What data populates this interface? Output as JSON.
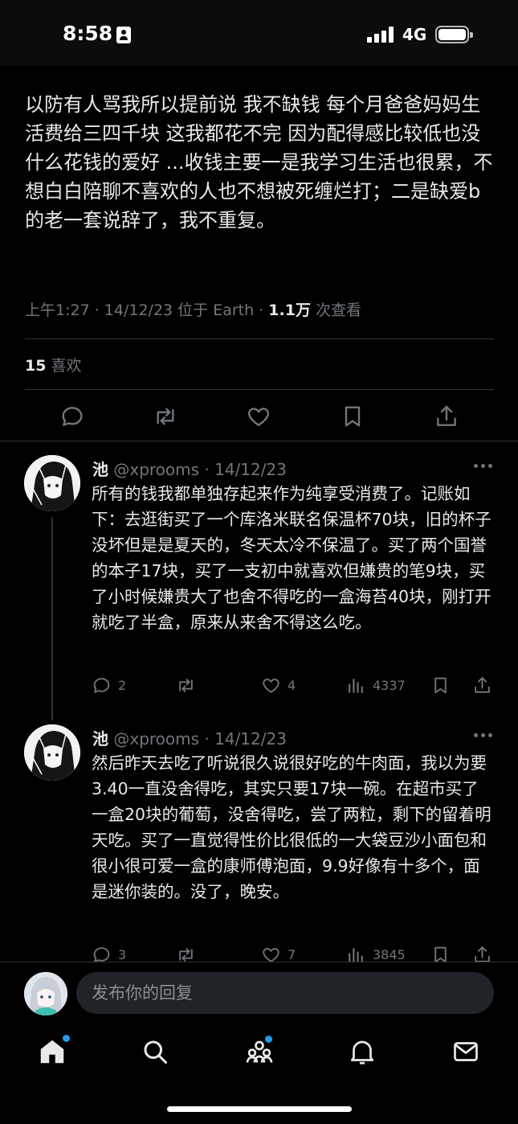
{
  "status_bar": {
    "time": "8:58",
    "network": "4G"
  },
  "tweet": {
    "text": "以防有人骂我所以提前说 我不缺钱 每个月爸爸妈妈生活费给三四千块 这我都花不完 因为配得感比较低也没什么花钱的爱好 ...收钱主要一是我学习生活也很累，不想白白陪聊不喜欢的人也不想被死缠烂打；二是缺爱b的老一套说辞了，我不重复。",
    "meta_prefix": "上午1:27 · 14/12/23 位于 Earth · ",
    "views_count": "1.1万",
    "views_label": " 次查看",
    "likes_count": "15",
    "likes_label": " 喜欢"
  },
  "replies": [
    {
      "name": "池",
      "handle_date": " @xprooms · 14/12/23",
      "text": "所有的钱我都单独存起来作为纯享受消费了。记账如下：去逛街买了一个库洛米联名保温杯70块，旧的杯子没坏但是是夏天的，冬天太冷不保温了。买了两个国誉的本子17块，买了一支初中就喜欢但嫌贵的笔9块，买了小时候嫌贵大了也舍不得吃的一盒海苔40块，刚打开就吃了半盒，原来从来舍不得这么吃。",
      "replies": "2",
      "likes": "4",
      "views": "4337"
    },
    {
      "name": "池",
      "handle_date": " @xprooms · 14/12/23",
      "text": "然后昨天去吃了听说很久说很好吃的牛肉面，我以为要3.40一直没舍得吃，其实只要17块一碗。在超市买了一盒20块的葡萄，没舍得吃，尝了两粒，剩下的留着明天吃。买了一直觉得性价比很低的一大袋豆沙小面包和很小很可爱一盒的康师傅泡面，9.9好像有十多个，面是迷你装的。没了，晚安。",
      "replies": "3",
      "likes": "7",
      "views": "3845"
    }
  ],
  "compose": {
    "placeholder": "发布你的回复"
  },
  "colors": {
    "background": "#000000",
    "text": "#e7e9ea",
    "muted": "#71767b",
    "accent": "#1d9bf0"
  }
}
